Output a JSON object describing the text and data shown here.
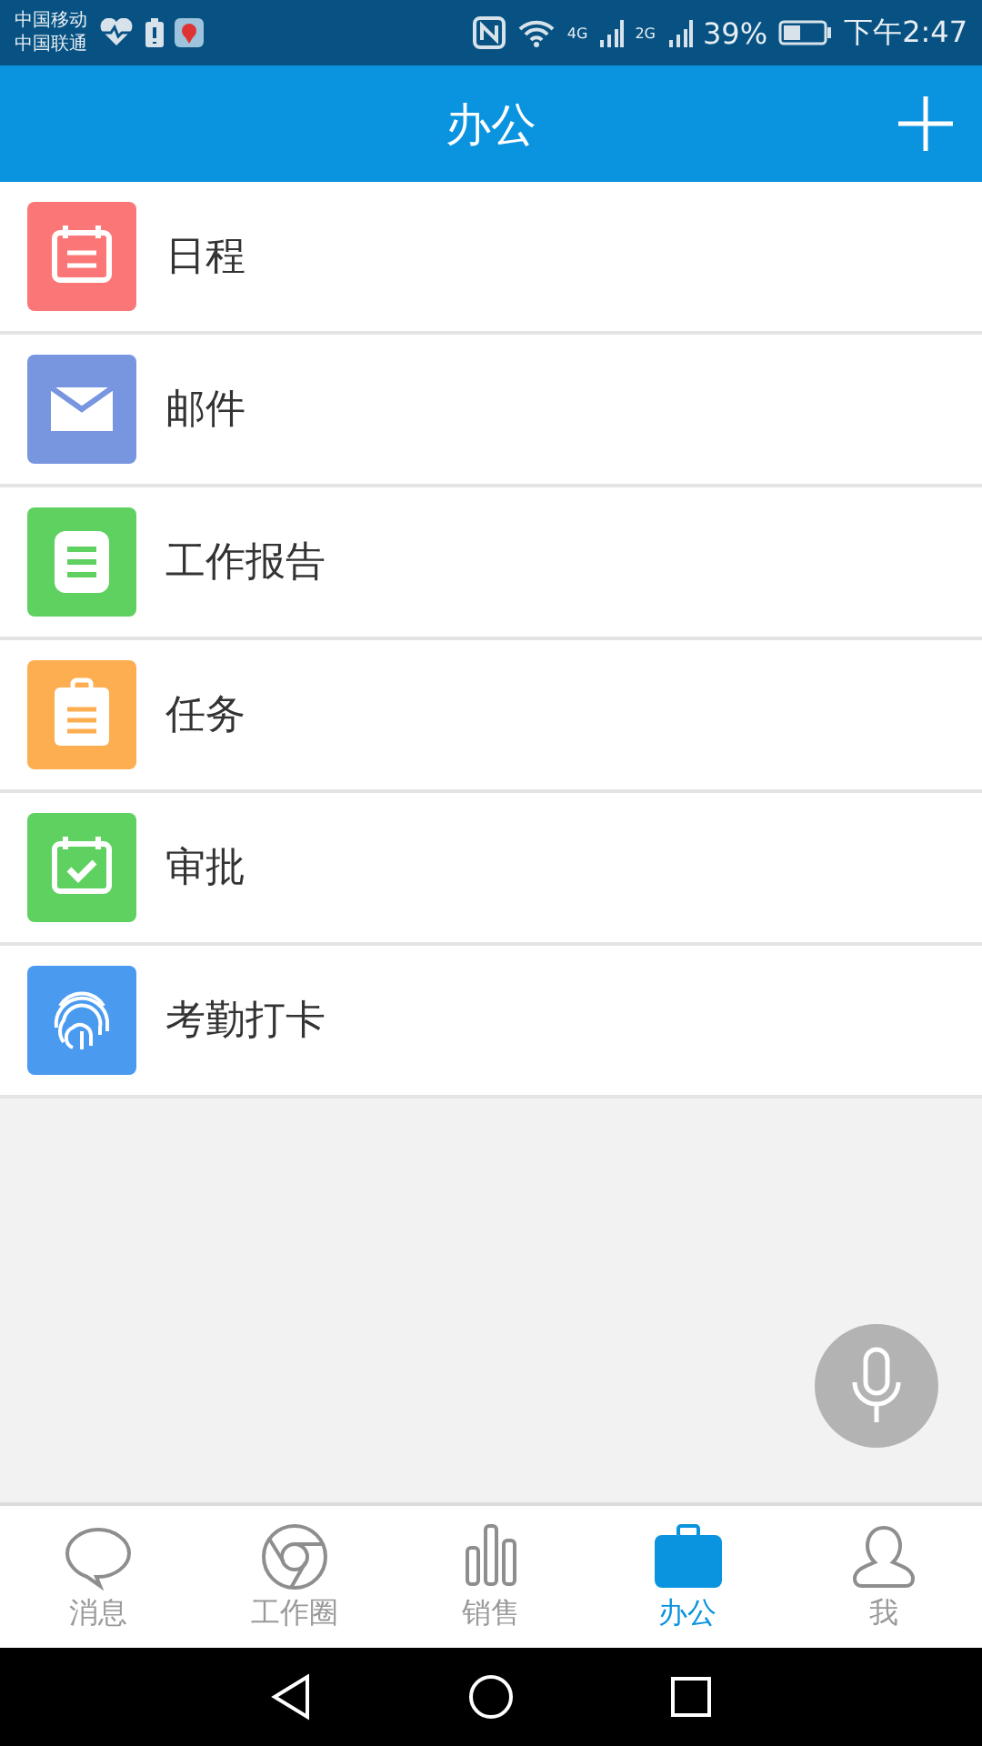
{
  "status_bar": {
    "carriers": [
      "中国移动",
      "中国联通"
    ],
    "network_1": "4G",
    "network_2": "2G",
    "battery": "39%",
    "time": "下午2:47"
  },
  "header": {
    "title": "办公"
  },
  "items": [
    {
      "label": "日程",
      "kind": "calendar",
      "color": "#fb7777"
    },
    {
      "label": "邮件",
      "kind": "mail",
      "color": "#7896e0"
    },
    {
      "label": "工作报告",
      "kind": "report",
      "color": "#5fd160"
    },
    {
      "label": "任务",
      "kind": "task",
      "color": "#fdae50"
    },
    {
      "label": "审批",
      "kind": "approval",
      "color": "#5fd160"
    },
    {
      "label": "考勤打卡",
      "kind": "fingerprint",
      "color": "#4a9bef"
    }
  ],
  "tabs": [
    {
      "label": "消息",
      "kind": "chat",
      "selected": false
    },
    {
      "label": "工作圈",
      "kind": "circle",
      "selected": false
    },
    {
      "label": "销售",
      "kind": "bars",
      "selected": false
    },
    {
      "label": "办公",
      "kind": "briefcase",
      "selected": true
    },
    {
      "label": "我",
      "kind": "person",
      "selected": false
    }
  ]
}
